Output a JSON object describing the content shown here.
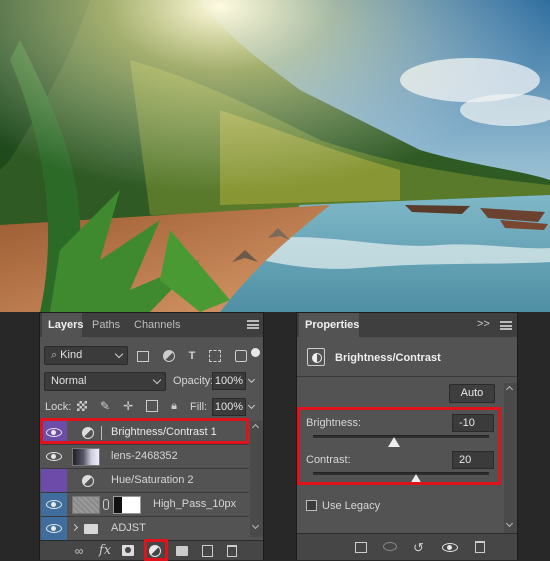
{
  "layers_panel": {
    "tabs": [
      "Layers",
      "Paths",
      "Channels"
    ],
    "filter_kind": "Kind",
    "blend_mode": "Normal",
    "opacity_label": "Opacity:",
    "opacity_value": "100%",
    "lock_label": "Lock:",
    "fill_label": "Fill:",
    "fill_value": "100%",
    "layers": [
      {
        "name": "Brightness/Contrast 1"
      },
      {
        "name": "lens-2468352"
      },
      {
        "name": "Hue/Saturation 2"
      },
      {
        "name": "High_Pass_10px"
      },
      {
        "name": "ADJST"
      }
    ],
    "footer_fx": "fx"
  },
  "properties_panel": {
    "tab": "Properties",
    "title": "Brightness/Contrast",
    "auto_label": "Auto",
    "brightness_label": "Brightness:",
    "brightness_value": "-10",
    "contrast_label": "Contrast:",
    "contrast_value": "20",
    "use_legacy_label": "Use Legacy",
    "collapse_glyph": ">>"
  },
  "colors": {
    "highlight": "#e0121b",
    "layer_tag_purple": "#6d4ba8",
    "layer_tag_blue": "#3f6e9e"
  },
  "icons": [
    "eye-icon",
    "adjustment-layer-icon",
    "link-icon",
    "folder-icon",
    "trash-icon",
    "new-layer-icon",
    "mask-icon",
    "brightness-icon"
  ]
}
